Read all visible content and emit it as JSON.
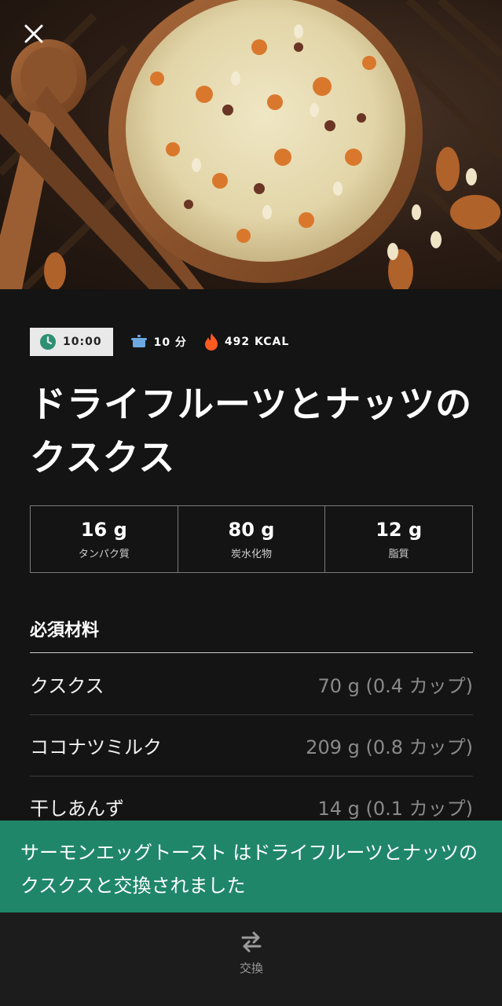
{
  "hero": {
    "image_alt": "dried fruit and nut couscous bowl"
  },
  "close": {
    "icon": "close-icon"
  },
  "meta": {
    "time": "10:00",
    "cook_time": "10 分",
    "calories": "492 KCAL"
  },
  "title": "ドライフルーツとナッツのクスクス",
  "macros": [
    {
      "value": "16 g",
      "label": "タンパク質"
    },
    {
      "value": "80 g",
      "label": "炭水化物"
    },
    {
      "value": "12 g",
      "label": "脂質"
    }
  ],
  "ingredients": {
    "heading": "必須材料",
    "items": [
      {
        "name": "クスクス",
        "qty": "70 g (0.4 カップ)"
      },
      {
        "name": "ココナツミルク",
        "qty": "209 g (0.8 カップ)"
      },
      {
        "name": "干しあんず",
        "qty": "14 g (0.1 カップ)"
      }
    ]
  },
  "toast": {
    "message": "サーモンエッグトースト はドライフルーツとナッツのクスクスと交換されました"
  },
  "bottom_bar": {
    "swap_label": "交換"
  },
  "colors": {
    "background": "#141414",
    "toast": "#20866a",
    "clock_icon": "#2f8f73",
    "pot_icon": "#6ea8e0",
    "flame_icon": "#ff5a1f"
  }
}
